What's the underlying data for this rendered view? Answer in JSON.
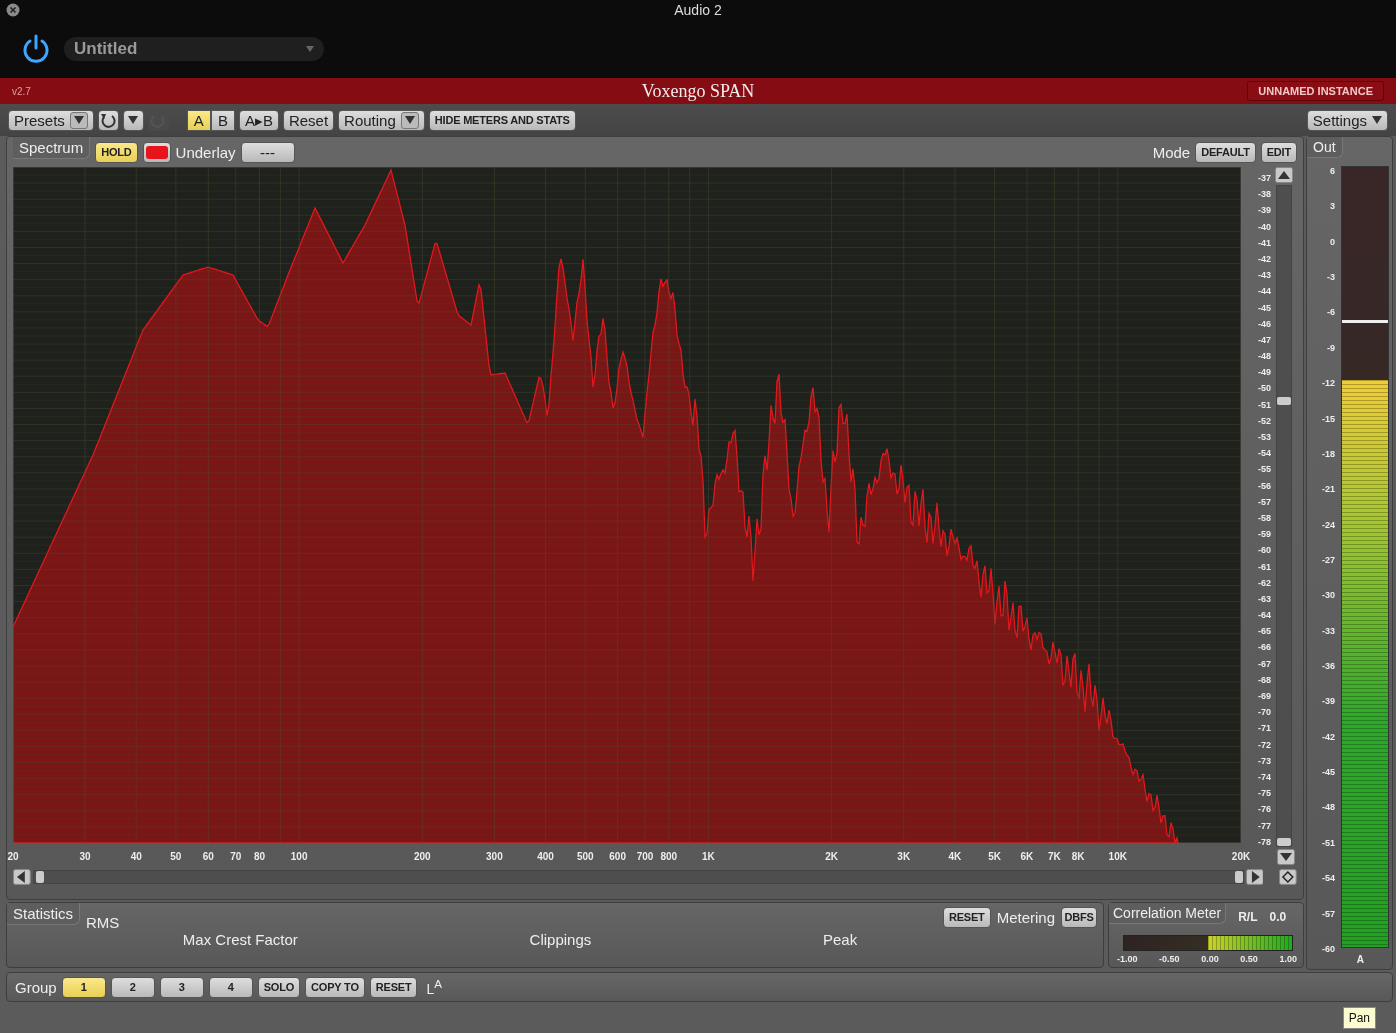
{
  "window": {
    "title": "Audio 2"
  },
  "host": {
    "power_on": true,
    "preset": "Untitled"
  },
  "plugin": {
    "version": "v2.7",
    "name": "Voxengo SPAN",
    "instance": "UNNAMED INSTANCE"
  },
  "toolbar": {
    "presets": "Presets",
    "redo_disabled": true,
    "ab": [
      {
        "label": "A",
        "selected": true
      },
      {
        "label": "B",
        "selected": false
      }
    ],
    "copy_ab": "A▸B",
    "reset": "Reset",
    "routing": "Routing",
    "hide_meters": "HIDE METERS AND STATS",
    "settings": "Settings"
  },
  "spectrum": {
    "tab": "Spectrum",
    "hold": {
      "label": "HOLD",
      "on": true
    },
    "color": "#e8141c",
    "underlay_label": "Underlay",
    "underlay_value": "---",
    "mode_label": "Mode",
    "mode_buttons": [
      "DEFAULT",
      "EDIT"
    ],
    "db_scale": [
      "-37",
      "-38",
      "-39",
      "-40",
      "-41",
      "-42",
      "-43",
      "-44",
      "-45",
      "-46",
      "-47",
      "-48",
      "-49",
      "-50",
      "-51",
      "-52",
      "-53",
      "-54",
      "-55",
      "-56",
      "-57",
      "-58",
      "-59",
      "-60",
      "-61",
      "-62",
      "-63",
      "-64",
      "-65",
      "-66",
      "-67",
      "-68",
      "-69",
      "-70",
      "-71",
      "-72",
      "-73",
      "-74",
      "-75",
      "-76",
      "-77",
      "-78"
    ],
    "freq_ticks": [
      "20",
      "30",
      "40",
      "50",
      "60",
      "70",
      "80",
      "100",
      "200",
      "300",
      "400",
      "500",
      "600",
      "700",
      "800",
      "1K",
      "2K",
      "3K",
      "4K",
      "5K",
      "6K",
      "7K",
      "8K",
      "10K",
      "20K"
    ]
  },
  "statistics": {
    "tab": "Statistics",
    "rms": "RMS",
    "max_crest": "Max Crest Factor",
    "clippings": "Clippings",
    "peak": "Peak",
    "reset": "RESET",
    "metering_label": "Metering",
    "metering_value": "DBFS"
  },
  "correlation": {
    "tab": "Correlation Meter",
    "channel": "R/L",
    "value": "0.0",
    "level": 1.0,
    "scale": [
      "-1.00",
      "-0.50",
      "0.00",
      "0.50",
      "1.00"
    ]
  },
  "out": {
    "tab": "Out",
    "level": 0.727,
    "peak_hold": {
      "level": 0.8
    },
    "channel": "A",
    "scale": [
      "6",
      "3",
      "0",
      "-3",
      "-6",
      "-9",
      "-12",
      "-15",
      "-18",
      "-21",
      "-24",
      "-27",
      "-30",
      "-33",
      "-36",
      "-39",
      "-42",
      "-45",
      "-48",
      "-51",
      "-54",
      "-57",
      "-60"
    ]
  },
  "group": {
    "label": "Group",
    "groups": [
      {
        "label": "1",
        "selected": true
      },
      {
        "label": "2",
        "selected": false
      },
      {
        "label": "3",
        "selected": false
      },
      {
        "label": "4",
        "selected": false
      }
    ],
    "buttons": [
      "SOLO",
      "COPY TO",
      "RESET"
    ],
    "channel": "L$^{A}$"
  },
  "tooltip": {
    "text": "Pan"
  }
}
